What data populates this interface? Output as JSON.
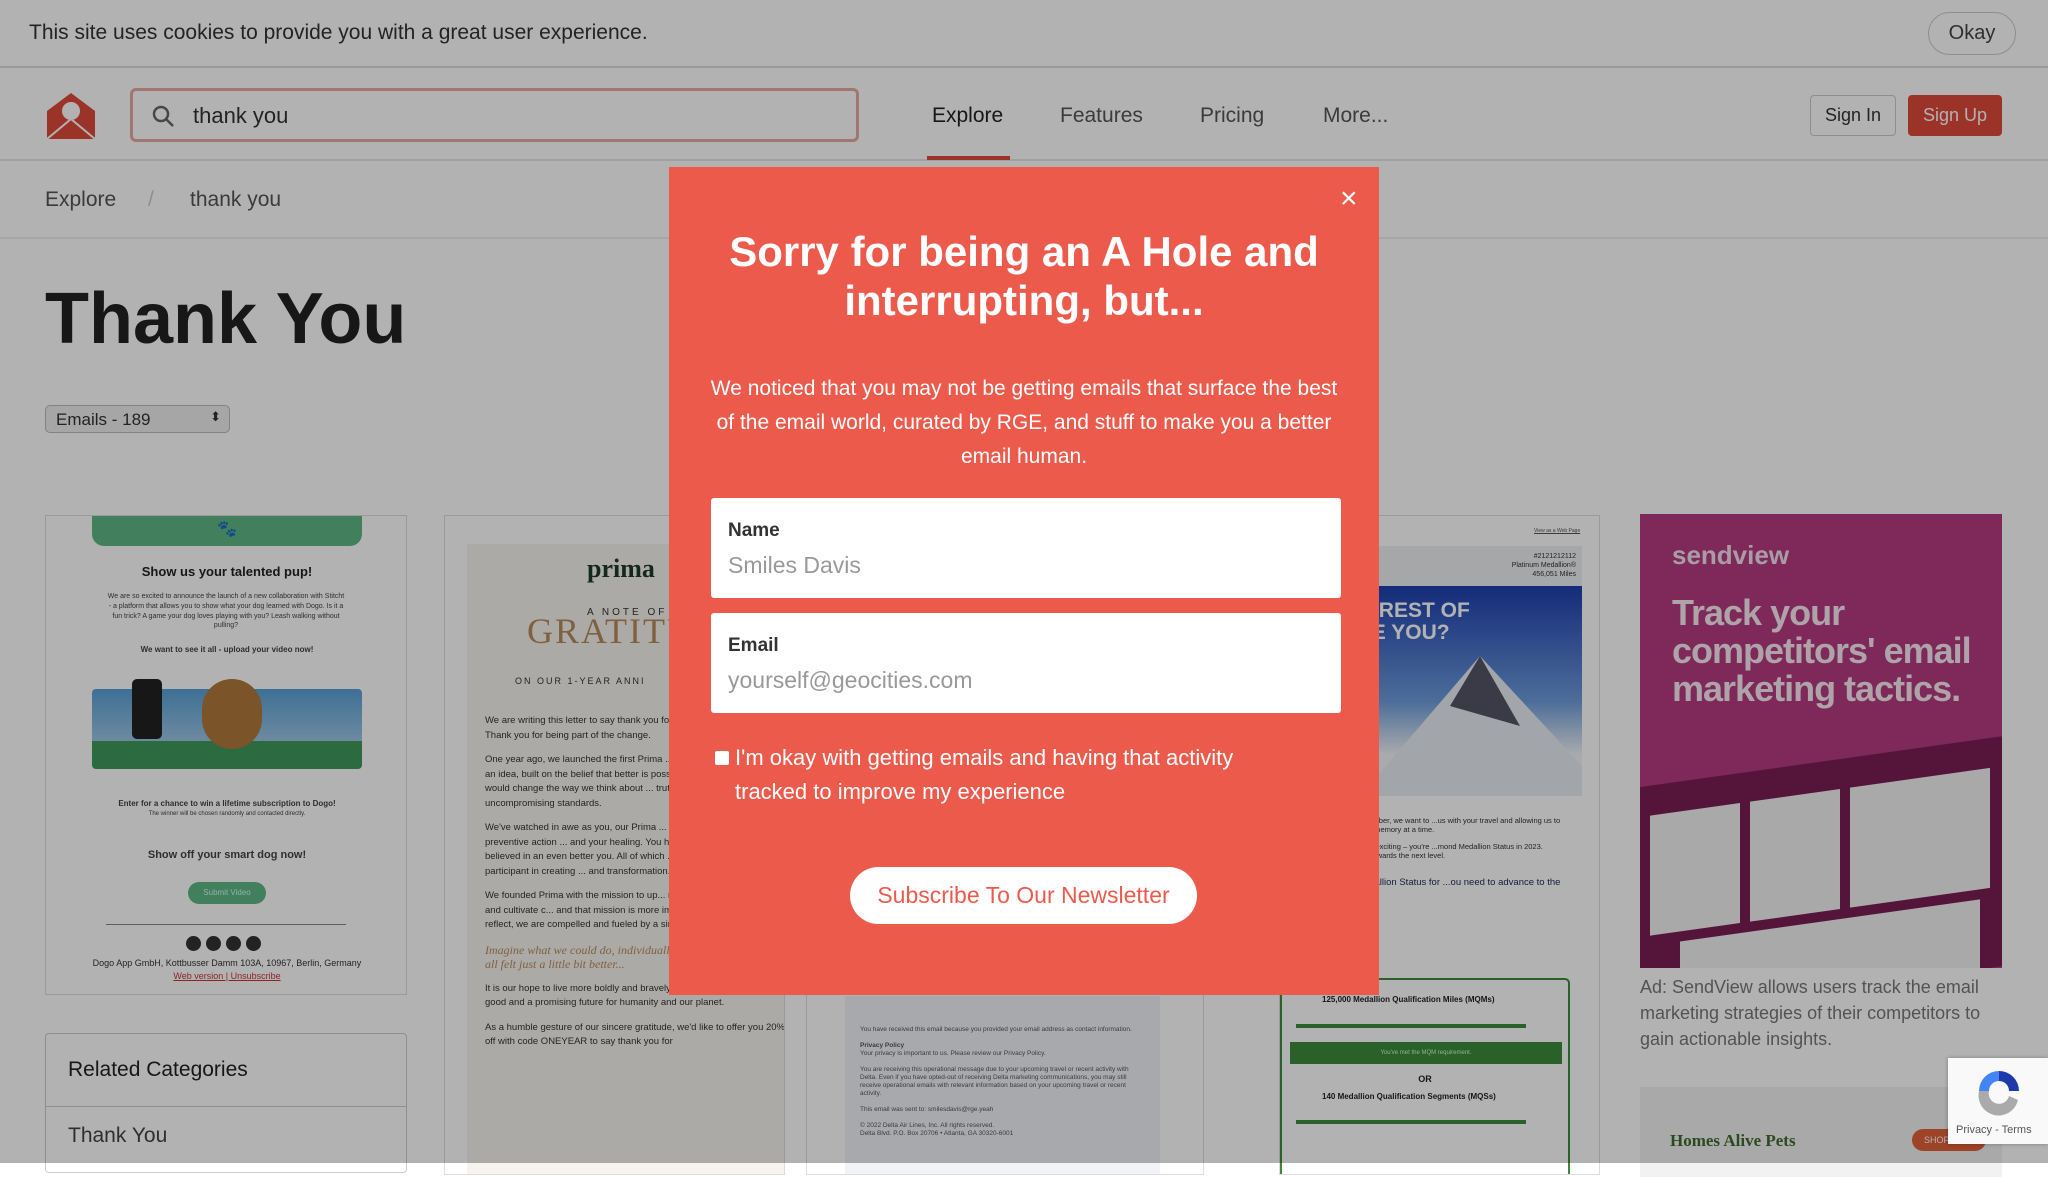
{
  "cookie": {
    "text": "This site uses cookies to provide you with a great user experience.",
    "okay": "Okay"
  },
  "header": {
    "search_value": "thank you",
    "nav": [
      "Explore",
      "Features",
      "Pricing",
      "More..."
    ],
    "active_nav": "Explore",
    "sign_in": "Sign In",
    "sign_up": "Sign Up"
  },
  "breadcrumb": {
    "root": "Explore",
    "sep": "/",
    "current": "thank you"
  },
  "page": {
    "title": "Thank You",
    "select": "Emails - 189"
  },
  "cards": {
    "dogo": {
      "heading": "Show us your talented pup!",
      "body": "We are so excited to announce the launch of a new collaboration with Stitcht - a platform that allows you to show what your dog learned with Dogo. Is it a fun trick? A game your dog loves playing with you? Leash walking without pulling?",
      "cta_line": "We want to see it all - upload your video now!",
      "enter": "Enter for a chance to win a lifetime subscription to Dogo!",
      "winner": "The winner will be chosen randomly and contacted directly.",
      "show_off": "Show off your smart dog now!",
      "button": "Submit Video",
      "address": "Dogo App GmbH, Kottbusser Damm 103A, 10967, Berlin, Germany",
      "links": "Web version  |  Unsubscribe"
    },
    "prima": {
      "logo": "prima",
      "note": "A NOTE OF",
      "big": "GRATITU",
      "sub": "ON OUR 1-YEAR ANNI",
      "paras": [
        "We are writing this letter to say thank you for being a part of our story. Thank you for being part of the change.",
        "One year ago, we launched the first Prima ... started as a tiny seed of an idea, built on the belief that better is possible. We set out to ... that would change the way we think about ... truth, integrity and uncompromising standards.",
        "We've watched in awe as you, our Prima ... welcomed us and taken preventive action ... and your healing. You have cared for yourself ... believed in an even better you. All of which ... you to be an active participant in creating ... and transformation.",
        "We founded Prima with the mission to up... nature to advance health and cultivate c... and that mission is more important now than ... we reflect, we are compelled and fueled by a simple yet radical thought:"
      ],
      "quote": "Imagine what we could do, individually and collectively, if we all felt just a little bit better...",
      "para_end": "It is our hope to live more boldly and bravely, collectively creating more good and a promising future for humanity and our planet.",
      "last": "As a humble gesture of our sincere gratitude, we'd like to offer you 20% off with code ONEYEAR to say thank you for"
    },
    "delta_footer": {
      "received": "You have received this email because you provided your email address as contact information.",
      "privacy_title": "Privacy Policy",
      "privacy": "Your privacy is important to us. Please review our Privacy Policy.",
      "operational": "You are receiving this operational message due to your upcoming travel or recent activity with Delta. Even if you have opted-out of receiving Delta marketing communications, you may still receive operational emails with relevant information based on your upcoming travel or recent activity.",
      "sent": "This email was sent to: smilesdavis@rge.yeah",
      "copyright": "© 2022 Delta Air Lines, Inc. All rights reserved.",
      "address": "Delta Blvd. P.O. Box 20706 • Atlanta, GA 30320-6001"
    },
    "delta": {
      "view": "View as a Web Page",
      "acct": "#2121212112",
      "tier": "Platinum Medallion®",
      "miles": "456,051 Miles",
      "hero1": "VILL THE REST OF",
      "hero2": "EAR TAKE YOU?",
      "p1": "...ed Platinum Medallion Member, we want to ...us with your travel and allowing us to connect ...orld one mile and memory at a time.",
      "p2": "...h the year, and even more exciting – you're ...mond Medallion Status in 2023. Explore ways ...ep earning towards the next level.",
      "h": "...ieving Diamond Medallion Status for ...ou need to advance to the next level:",
      "mqm": "125,000 Medallion Qualification Miles (MQMs)",
      "met": "You've met the MQM requirement.",
      "or": "OR",
      "mqs": "140 Medallion Qualification Segments (MQSs)"
    },
    "ad": {
      "brand": "sendview",
      "headline": "Track your competitors' email marketing tactics.",
      "caption": "Ad: SendView allows users track the email marketing strategies of their competitors to gain actionable insights.",
      "next_brand": "Homes Alive Pets",
      "next_btn": "SHOP NOW"
    }
  },
  "related": {
    "title": "Related Categories",
    "items": [
      "Thank You"
    ]
  },
  "recaptcha": {
    "text": "Privacy - Terms"
  },
  "modal": {
    "title": "Sorry for being an A Hole and interrupting, but...",
    "body": "We noticed that you may not be getting emails that surface the best of the email world, curated by RGE, and stuff to make you a better email human.",
    "name_label": "Name",
    "name_placeholder": "Smiles Davis",
    "email_label": "Email",
    "email_placeholder": "yourself@geocities.com",
    "consent": "I'm okay with getting emails and having that activity tracked to improve my experience",
    "consent_checked": false,
    "submit": "Subscribe To Our Newsletter",
    "close": "×"
  },
  "colors": {
    "brand": "#e04a3b",
    "modal": "#ec5a4c",
    "dogo_green": "#5fb684",
    "ad_magenta": "#b63a82"
  }
}
